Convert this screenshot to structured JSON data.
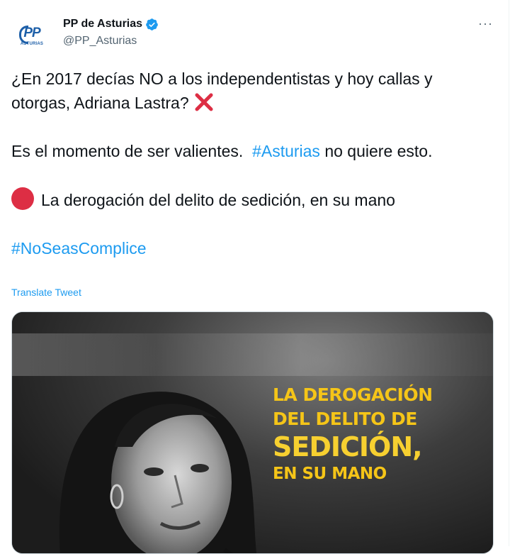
{
  "author": {
    "display_name": "PP de Asturias",
    "handle": "@PP_Asturias",
    "avatar_logo": "PP",
    "avatar_sub": "ASTURIAS",
    "verified": true
  },
  "more_icon": "···",
  "tweet": {
    "line1": "¿En 2017 decías NO a los independentistas y hoy callas y otorgas, Adriana Lastra?",
    "line2_pre": "Es el momento de ser valientes.",
    "line2_hashtag": "#Asturias",
    "line2_post": "no quiere esto.",
    "line3": "La derogación del delito de sedición, en su mano",
    "hashtag": "#NoSeasComplice"
  },
  "translate_label": "Translate Tweet",
  "media": {
    "caption_line1": "LA DEROGACIÓN",
    "caption_line2": "DEL DELITO DE",
    "caption_line3": "SEDICIÓN,",
    "caption_line4": "EN SU MANO"
  },
  "colors": {
    "link": "#1d9bf0",
    "caption": "#f5c518",
    "red_dot": "#dd2e44"
  }
}
